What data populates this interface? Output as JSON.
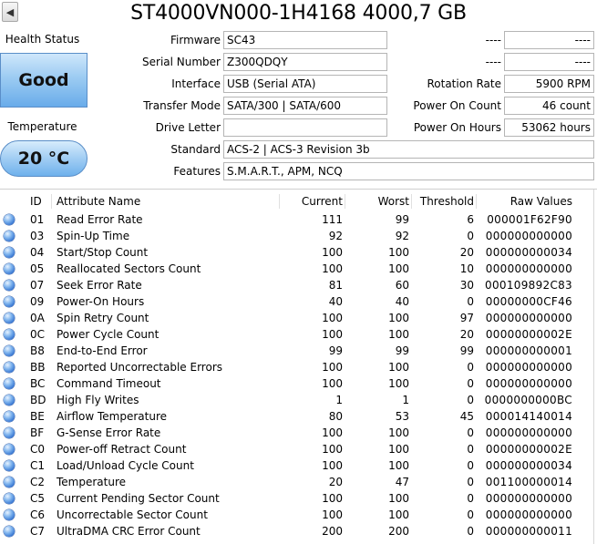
{
  "title": "ST4000VN000-1H4168 4000,7 GB",
  "health": {
    "label": "Health Status",
    "status": "Good"
  },
  "temperature": {
    "label": "Temperature",
    "value": "20 °C"
  },
  "info": {
    "firmware": {
      "label": "Firmware",
      "value": "SC43"
    },
    "serial": {
      "label": "Serial Number",
      "value": "Z300QDQY"
    },
    "interface": {
      "label": "Interface",
      "value": "USB (Serial ATA)"
    },
    "transfer": {
      "label": "Transfer Mode",
      "value": "SATA/300 | SATA/600"
    },
    "drive_letter": {
      "label": "Drive Letter",
      "value": ""
    },
    "standard": {
      "label": "Standard",
      "value": "ACS-2 | ACS-3 Revision 3b"
    },
    "features": {
      "label": "Features",
      "value": "S.M.A.R.T., APM, NCQ"
    }
  },
  "right_info": {
    "blank1": {
      "label": "----",
      "value": "----"
    },
    "blank2": {
      "label": "----",
      "value": "----"
    },
    "rotation": {
      "label": "Rotation Rate",
      "value": "5900 RPM"
    },
    "power_count": {
      "label": "Power On Count",
      "value": "46 count"
    },
    "power_hours": {
      "label": "Power On Hours",
      "value": "53062 hours"
    }
  },
  "table": {
    "headers": {
      "id": "ID",
      "name": "Attribute Name",
      "current": "Current",
      "worst": "Worst",
      "threshold": "Threshold",
      "raw": "Raw Values"
    },
    "rows": [
      {
        "id": "01",
        "name": "Read Error Rate",
        "current": "111",
        "worst": "99",
        "threshold": "6",
        "raw": "000001F62F90"
      },
      {
        "id": "03",
        "name": "Spin-Up Time",
        "current": "92",
        "worst": "92",
        "threshold": "0",
        "raw": "000000000000"
      },
      {
        "id": "04",
        "name": "Start/Stop Count",
        "current": "100",
        "worst": "100",
        "threshold": "20",
        "raw": "000000000034"
      },
      {
        "id": "05",
        "name": "Reallocated Sectors Count",
        "current": "100",
        "worst": "100",
        "threshold": "10",
        "raw": "000000000000"
      },
      {
        "id": "07",
        "name": "Seek Error Rate",
        "current": "81",
        "worst": "60",
        "threshold": "30",
        "raw": "000109892C83"
      },
      {
        "id": "09",
        "name": "Power-On Hours",
        "current": "40",
        "worst": "40",
        "threshold": "0",
        "raw": "00000000CF46"
      },
      {
        "id": "0A",
        "name": "Spin Retry Count",
        "current": "100",
        "worst": "100",
        "threshold": "97",
        "raw": "000000000000"
      },
      {
        "id": "0C",
        "name": "Power Cycle Count",
        "current": "100",
        "worst": "100",
        "threshold": "20",
        "raw": "00000000002E"
      },
      {
        "id": "B8",
        "name": "End-to-End Error",
        "current": "99",
        "worst": "99",
        "threshold": "99",
        "raw": "000000000001"
      },
      {
        "id": "BB",
        "name": "Reported Uncorrectable Errors",
        "current": "100",
        "worst": "100",
        "threshold": "0",
        "raw": "000000000000"
      },
      {
        "id": "BC",
        "name": "Command Timeout",
        "current": "100",
        "worst": "100",
        "threshold": "0",
        "raw": "000000000000"
      },
      {
        "id": "BD",
        "name": "High Fly Writes",
        "current": "1",
        "worst": "1",
        "threshold": "0",
        "raw": "0000000000BC"
      },
      {
        "id": "BE",
        "name": "Airflow Temperature",
        "current": "80",
        "worst": "53",
        "threshold": "45",
        "raw": "000014140014"
      },
      {
        "id": "BF",
        "name": "G-Sense Error Rate",
        "current": "100",
        "worst": "100",
        "threshold": "0",
        "raw": "000000000000"
      },
      {
        "id": "C0",
        "name": "Power-off Retract Count",
        "current": "100",
        "worst": "100",
        "threshold": "0",
        "raw": "00000000002E"
      },
      {
        "id": "C1",
        "name": "Load/Unload Cycle Count",
        "current": "100",
        "worst": "100",
        "threshold": "0",
        "raw": "000000000034"
      },
      {
        "id": "C2",
        "name": "Temperature",
        "current": "20",
        "worst": "47",
        "threshold": "0",
        "raw": "001100000014"
      },
      {
        "id": "C5",
        "name": "Current Pending Sector Count",
        "current": "100",
        "worst": "100",
        "threshold": "0",
        "raw": "000000000000"
      },
      {
        "id": "C6",
        "name": "Uncorrectable Sector Count",
        "current": "100",
        "worst": "100",
        "threshold": "0",
        "raw": "000000000000"
      },
      {
        "id": "C7",
        "name": "UltraDMA CRC Error Count",
        "current": "200",
        "worst": "200",
        "threshold": "0",
        "raw": "000000000011"
      }
    ]
  }
}
